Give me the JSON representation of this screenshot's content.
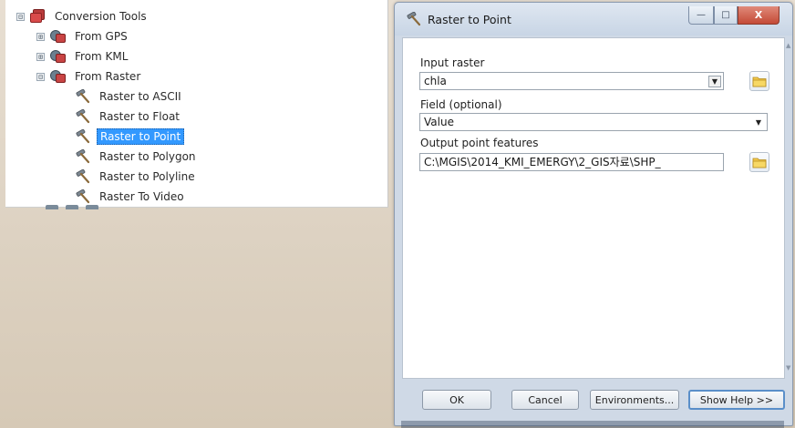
{
  "tree": {
    "root": {
      "expander": "⊟",
      "label": "Conversion Tools",
      "icon": "toolbox-icon"
    },
    "items": [
      {
        "expander": "⊞",
        "label": "From GPS",
        "icon": "toolset-icon"
      },
      {
        "expander": "⊞",
        "label": "From KML",
        "icon": "toolset-icon"
      },
      {
        "expander": "⊟",
        "label": "From Raster",
        "icon": "toolset-icon"
      }
    ],
    "tools": [
      {
        "label": "Raster to ASCII",
        "selected": false
      },
      {
        "label": "Raster to Float",
        "selected": false
      },
      {
        "label": "Raster to Point",
        "selected": true
      },
      {
        "label": "Raster to Polygon",
        "selected": false
      },
      {
        "label": "Raster to Polyline",
        "selected": false
      },
      {
        "label": "Raster To Video",
        "selected": false
      }
    ]
  },
  "dialog": {
    "title": "Raster to Point",
    "close_symbol": "X",
    "min_symbol": "—",
    "max_symbol": "□",
    "input_raster": {
      "label": "Input raster",
      "value": "chla"
    },
    "field": {
      "label": "Field (optional)",
      "value": "Value"
    },
    "output": {
      "label": "Output point features",
      "value": "C:\\MGIS\\2014_KMI_EMERGY\\2_GIS자료\\SHP_"
    },
    "buttons": {
      "ok": "OK",
      "cancel": "Cancel",
      "environments": "Environments...",
      "show_help": "Show Help >>"
    }
  },
  "colors": {
    "selection": "#3399ff",
    "toolbox_red": "#d94a4a",
    "dialog_frame": "#cfd9e6",
    "close_red": "#c44a36"
  }
}
